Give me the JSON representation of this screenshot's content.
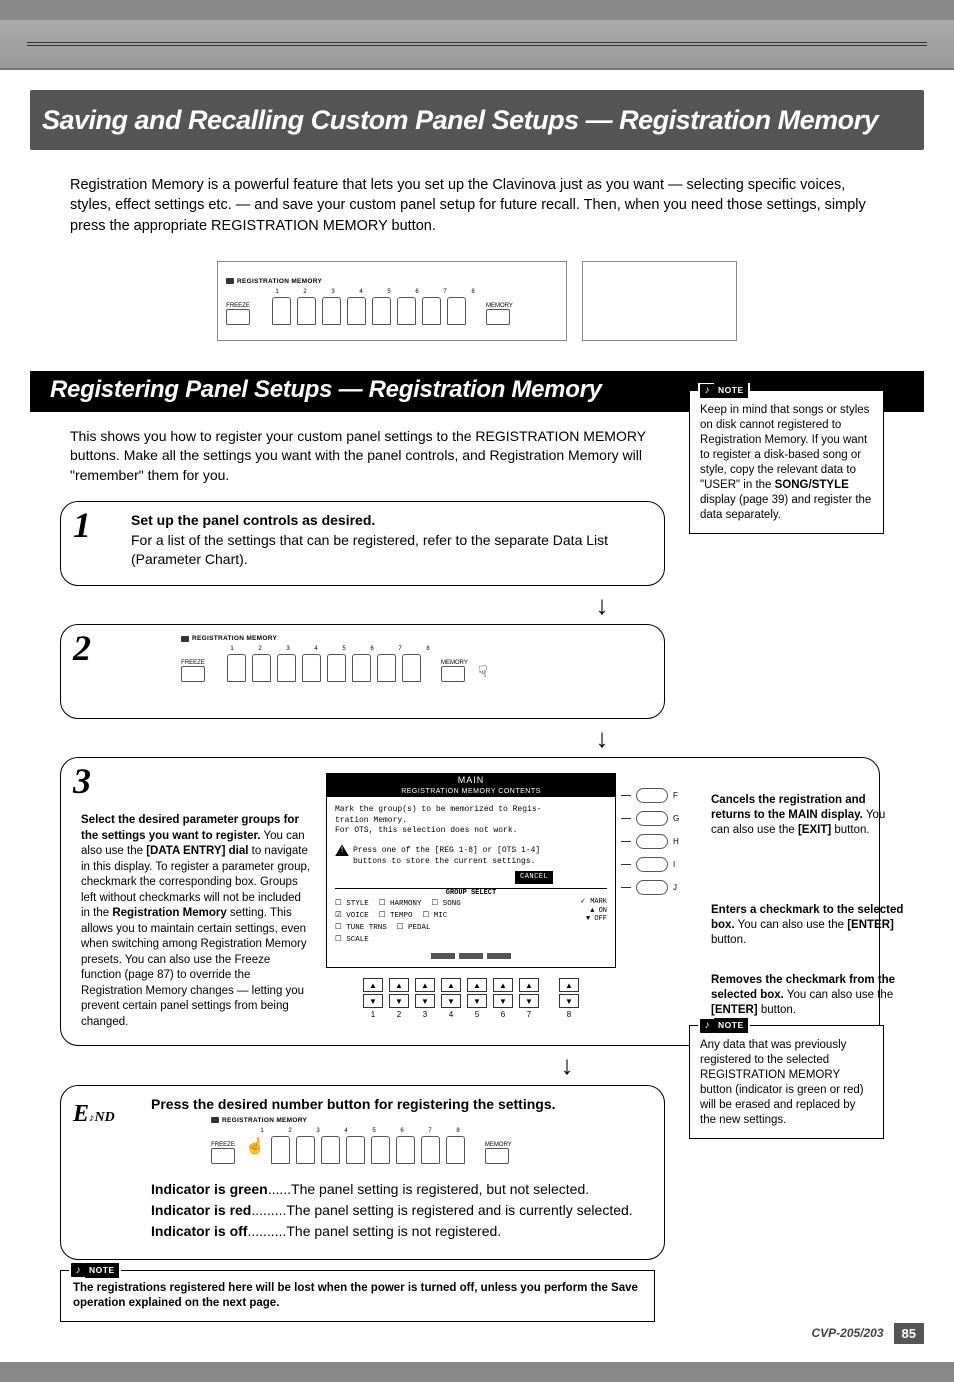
{
  "page_title": "Saving and Recalling Custom Panel Setups — Registration Memory",
  "intro": "Registration Memory is a powerful feature that lets you set up the Clavinova just as you want — selecting specific voices, styles, effect settings etc. — and save your custom panel setup for future recall. Then, when you need those settings, simply press the appropriate REGISTRATION MEMORY button.",
  "panel": {
    "label": "REGISTRATION MEMORY",
    "freeze": "FREEZE",
    "memory": "MEMORY",
    "numbers": [
      "1",
      "2",
      "3",
      "4",
      "5",
      "6",
      "7",
      "8"
    ]
  },
  "section_title": "Registering Panel Setups — Registration Memory",
  "section_intro": "This shows you how to register your custom panel settings to the REGISTRATION MEMORY buttons. Make all the settings you want with the panel controls, and Registration Memory will \"remember\" them for you.",
  "note1": {
    "label": "NOTE",
    "text_a": "Keep in mind that songs or styles on disk cannot registered to Registration Memory. If you want to register a disk-based song or style, copy the relevant data to \"USER\" in the ",
    "bold": "SONG/STYLE",
    "text_b": " display (page 39) and register the data separately."
  },
  "step1": {
    "num": "1",
    "title": "Set up the panel controls as desired.",
    "desc": "For a list of the settings that can be registered, refer to the separate Data List (Parameter Chart)."
  },
  "step2": {
    "num": "2"
  },
  "step3": {
    "num": "3",
    "text_a": "Select the desired parameter groups for the settings you want to register.",
    "text_b": " You can also use the ",
    "bold_b": "[DATA ENTRY] dial",
    "text_c": " to navigate in this display. To register a parameter group, checkmark the corresponding box. Groups left without checkmarks will not be included in the ",
    "bold_c": "Registration Memory",
    "text_d": " setting. This allows you to maintain certain settings, even when switching among Registration Memory presets. You can also use the Freeze function (page 87) to override the Registration Memory changes — letting you prevent certain panel settings from being changed."
  },
  "screen": {
    "header": "MAIN",
    "subheader": "REGISTRATION MEMORY CONTENTS",
    "line1": "Mark the group(s) to be memorized to Regis-",
    "line2": "tration Memory.",
    "line3": "For OTS, this selection does not work.",
    "line4": "Press one of the [REG 1-8] or [OTS 1-4]",
    "line5": "buttons to store the current settings.",
    "cancel": "CANCEL",
    "gs_label": "GROUP SELECT",
    "mark": "✓ MARK",
    "on": "▲ ON",
    "off": "▼ OFF",
    "groups_row1": [
      "☐ STYLE",
      "☐ HARMONY",
      "☐ SONG"
    ],
    "groups_row2": [
      "☑ VOICE",
      "☐ TEMPO",
      "☐ MIC"
    ],
    "groups_row3": [
      "☐ TUNE TRNS",
      "☐ PEDAL"
    ],
    "groups_row4": [
      "☐ SCALE"
    ],
    "side_labels": [
      "F",
      "G",
      "H",
      "I",
      "J"
    ],
    "row_nums": [
      "1",
      "2",
      "3",
      "4",
      "5",
      "6",
      "7",
      "8"
    ]
  },
  "callout1": {
    "b": "Cancels the registration and returns to the MAIN display.",
    "t": " You can also use the ",
    "bb": "[EXIT]",
    "tt": " button."
  },
  "callout2": {
    "b": "Enters a checkmark to the selected box.",
    "t": " You can also use the ",
    "bb": "[ENTER]",
    "tt": " button."
  },
  "callout3": {
    "b": "Removes the checkmark from the selected box.",
    "t": " You can also use the ",
    "bb": "[ENTER]",
    "tt": " button."
  },
  "step_end": {
    "E": "E",
    "ND": "ND",
    "title": "Press the desired number button for registering the settings.",
    "ind": [
      {
        "lbl": "Indicator is green",
        "dots": "......",
        "txt": "The panel setting is registered, but not selected."
      },
      {
        "lbl": "Indicator is red",
        "dots": ".........",
        "txt": "The panel setting is registered and is currently selected."
      },
      {
        "lbl": "Indicator is off",
        "dots": "..........",
        "txt": "The panel setting is not registered."
      }
    ]
  },
  "note2": {
    "label": "NOTE",
    "text": "Any data that was previously registered to the selected REGISTRATION MEMORY button (indicator is green or red) will be erased and replaced by the new settings."
  },
  "note3": {
    "label": "NOTE",
    "text": "The registrations registered here will be lost when the power is turned off, unless you perform the Save operation explained on the next page."
  },
  "footer": {
    "model": "CVP-205/203",
    "page": "85"
  }
}
